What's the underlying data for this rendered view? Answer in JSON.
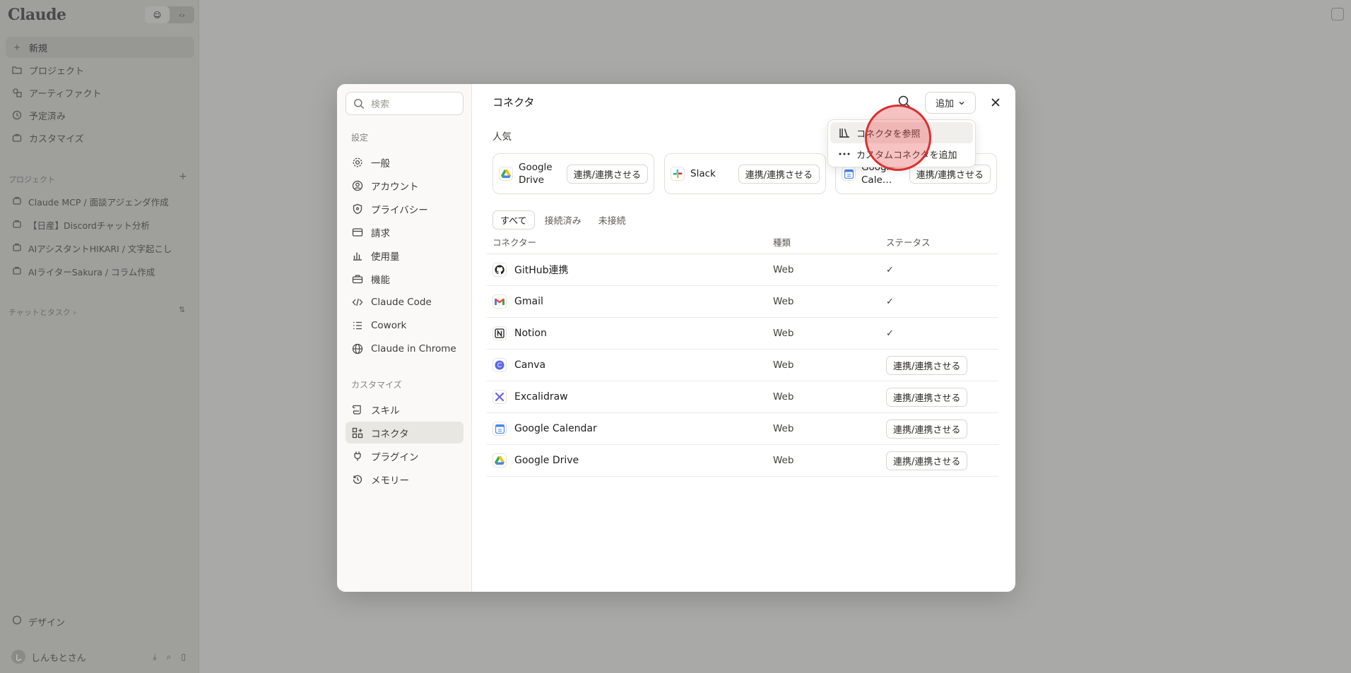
{
  "app": {
    "brand": "Claude",
    "toggle": [
      "☺",
      "‹›"
    ],
    "nav": [
      {
        "icon": "plus-icon",
        "label": "新規"
      },
      {
        "icon": "folder-icon",
        "label": "プロジェクト"
      },
      {
        "icon": "artifact-icon",
        "label": "アーティファクト"
      },
      {
        "icon": "clock-icon",
        "label": "予定済み"
      },
      {
        "icon": "briefcase-icon",
        "label": "カスタマイズ"
      }
    ],
    "projects_label": "プロジェクト",
    "projects_add": "+",
    "projects": [
      "Claude MCP / 面談アジェンダ作成",
      "【日産】Discordチャット分析",
      "AIアシスタントHIKARI / 文字起こし",
      "AIライターSakura / コラム作成"
    ],
    "chats_label": "チャットとタスク ›",
    "chats_badge": "⇅",
    "design_label": "デザイン",
    "user": {
      "initial": "し",
      "name": "しんもとさん"
    }
  },
  "settings": {
    "search_placeholder": "検索",
    "section_settings": "設定",
    "items": [
      {
        "name": "general",
        "label": "一般"
      },
      {
        "name": "account",
        "label": "アカウント"
      },
      {
        "name": "privacy",
        "label": "プライバシー"
      },
      {
        "name": "billing",
        "label": "請求"
      },
      {
        "name": "usage",
        "label": "使用量"
      },
      {
        "name": "features",
        "label": "機能"
      },
      {
        "name": "claude-code",
        "label": "Claude Code"
      },
      {
        "name": "cowork",
        "label": "Cowork"
      },
      {
        "name": "claude-in-chrome",
        "label": "Claude in Chrome"
      }
    ],
    "section_customize": "カスタマイズ",
    "customize_items": [
      {
        "name": "skills",
        "label": "スキル"
      },
      {
        "name": "connectors",
        "label": "コネクタ"
      },
      {
        "name": "plugins",
        "label": "プラグイン"
      },
      {
        "name": "memory",
        "label": "メモリー"
      }
    ]
  },
  "connectors": {
    "title": "コネクタ",
    "add_label": "追加",
    "popular_label": "人気",
    "popular": [
      {
        "name": "Google\nDrive",
        "button": "連携/連携させる"
      },
      {
        "name": "Slack",
        "button": "連携/連携させる"
      },
      {
        "name": "Google\nCale…",
        "button": "連携/連携させる"
      }
    ],
    "tabs": [
      "すべて",
      "接続済み",
      "未接続"
    ],
    "columns": [
      "コネクター",
      "種類",
      "ステータス"
    ],
    "rows": [
      {
        "name": "GitHub連携",
        "type": "Web",
        "status": "✓",
        "connected": true
      },
      {
        "name": "Gmail",
        "type": "Web",
        "status": "✓",
        "connected": true
      },
      {
        "name": "Notion",
        "type": "Web",
        "status": "✓",
        "connected": true
      },
      {
        "name": "Canva",
        "type": "Web",
        "status": "連携/連携させる",
        "connected": false
      },
      {
        "name": "Excalidraw",
        "type": "Web",
        "status": "連携/連携させる",
        "connected": false
      },
      {
        "name": "Google Calendar",
        "type": "Web",
        "status": "連携/連携させる",
        "connected": false
      },
      {
        "name": "Google Drive",
        "type": "Web",
        "status": "連携/連携させる",
        "connected": false
      }
    ],
    "dropdown": [
      {
        "icon": "library-icon",
        "label": "コネクタを参照"
      },
      {
        "icon": "more-icon",
        "label": "カスタムコネクタを追加"
      }
    ]
  }
}
